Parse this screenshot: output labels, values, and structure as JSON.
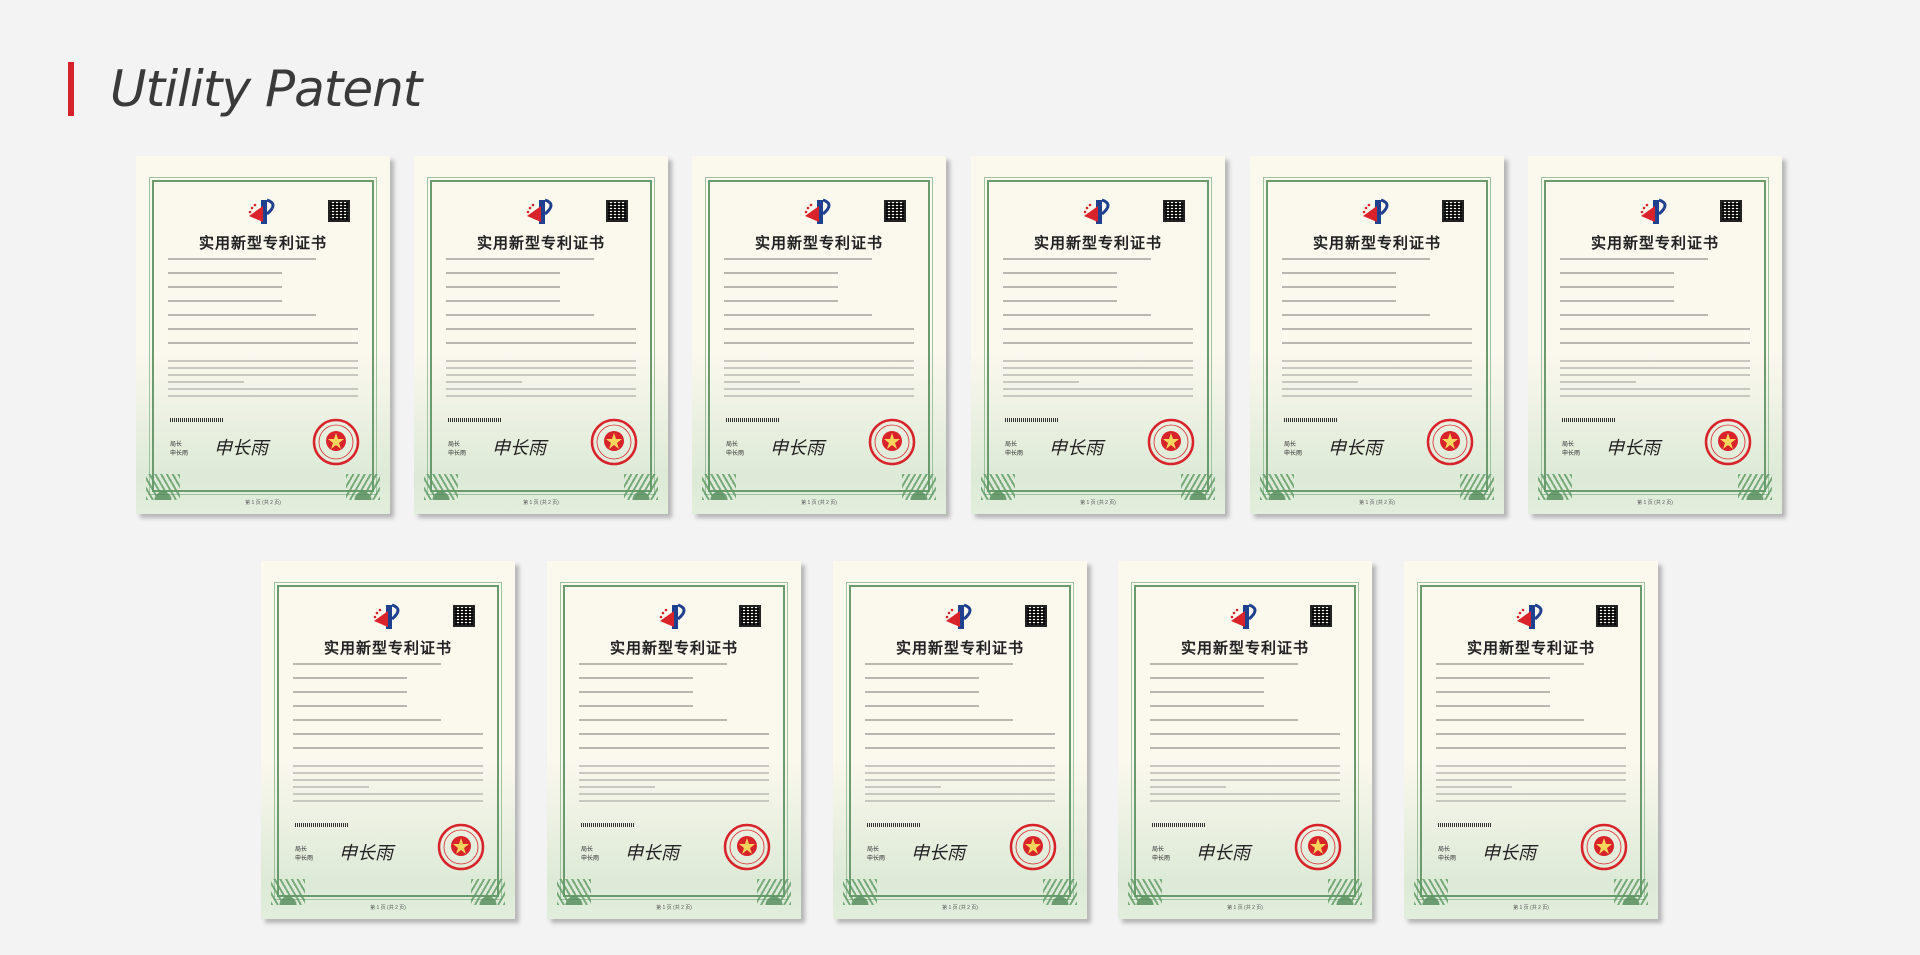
{
  "header": {
    "title": "Utility Patent",
    "accent_color": "#d6222b"
  },
  "certificate": {
    "title": "实用新型专利证书",
    "signature": "申长雨",
    "footer": "第 1 页 (共 2 页)",
    "seal_icon": "state-ip-office-seal-icon",
    "logo_icon": "cnipa-logo-icon",
    "frame_color": "#6a9a6e",
    "seal_color": "#d8232a"
  },
  "certificates": [
    {
      "id": "1"
    },
    {
      "id": "2"
    },
    {
      "id": "3"
    },
    {
      "id": "4"
    },
    {
      "id": "5"
    },
    {
      "id": "6"
    },
    {
      "id": "7"
    },
    {
      "id": "8"
    },
    {
      "id": "9"
    },
    {
      "id": "10"
    },
    {
      "id": "11"
    }
  ]
}
